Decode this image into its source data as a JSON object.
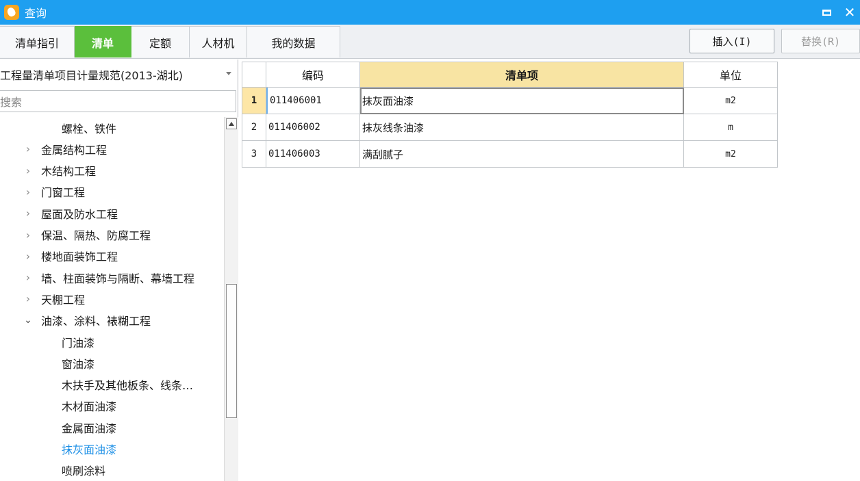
{
  "window": {
    "title": "查询",
    "minimize_icon": "minimize-icon",
    "close_glyph": "✕"
  },
  "tabs": [
    {
      "label": "清单指引",
      "active": false
    },
    {
      "label": "清单",
      "active": true
    },
    {
      "label": "定额",
      "active": false
    },
    {
      "label": "人材机",
      "active": false
    },
    {
      "label": "我的数据",
      "active": false
    }
  ],
  "buttons": {
    "insert": "插入(I)",
    "replace": "替换(R)"
  },
  "left": {
    "spec_selected": "工程量清单项目计量规范(2013-湖北)",
    "search_placeholder": "搜索",
    "tree": [
      {
        "label": "螺栓、铁件",
        "level": 2,
        "arrow": ""
      },
      {
        "label": "金属结构工程",
        "level": 1,
        "arrow": "›"
      },
      {
        "label": "木结构工程",
        "level": 1,
        "arrow": "›"
      },
      {
        "label": "门窗工程",
        "level": 1,
        "arrow": "›"
      },
      {
        "label": "屋面及防水工程",
        "level": 1,
        "arrow": "›"
      },
      {
        "label": "保温、隔热、防腐工程",
        "level": 1,
        "arrow": "›"
      },
      {
        "label": "楼地面装饰工程",
        "level": 1,
        "arrow": "›"
      },
      {
        "label": "墙、柱面装饰与隔断、幕墙工程",
        "level": 1,
        "arrow": "›"
      },
      {
        "label": "天棚工程",
        "level": 1,
        "arrow": "›"
      },
      {
        "label": "油漆、涂料、裱糊工程",
        "level": 1,
        "arrow": "⌄"
      },
      {
        "label": "门油漆",
        "level": 2,
        "arrow": ""
      },
      {
        "label": "窗油漆",
        "level": 2,
        "arrow": ""
      },
      {
        "label": "木扶手及其他板条、线条…",
        "level": 2,
        "arrow": ""
      },
      {
        "label": "木材面油漆",
        "level": 2,
        "arrow": ""
      },
      {
        "label": "金属面油漆",
        "level": 2,
        "arrow": ""
      },
      {
        "label": "抹灰面油漆",
        "level": 2,
        "arrow": "",
        "selected": true
      },
      {
        "label": "喷刷涂料",
        "level": 2,
        "arrow": ""
      }
    ]
  },
  "grid": {
    "headers": {
      "code": "编码",
      "item": "清单项",
      "unit": "单位"
    },
    "rows": [
      {
        "no": "1",
        "code": "011406001",
        "item": "抹灰面油漆",
        "unit": "m2"
      },
      {
        "no": "2",
        "code": "011406002",
        "item": "抹灰线条油漆",
        "unit": "m"
      },
      {
        "no": "3",
        "code": "011406003",
        "item": "满刮腻子",
        "unit": "m2"
      }
    ]
  },
  "colors": {
    "titlebar": "#1e9ff0",
    "active_tab": "#5bbf3c",
    "sorted_header": "#f8e4a3",
    "selected_tree_text": "#1e90e6"
  }
}
